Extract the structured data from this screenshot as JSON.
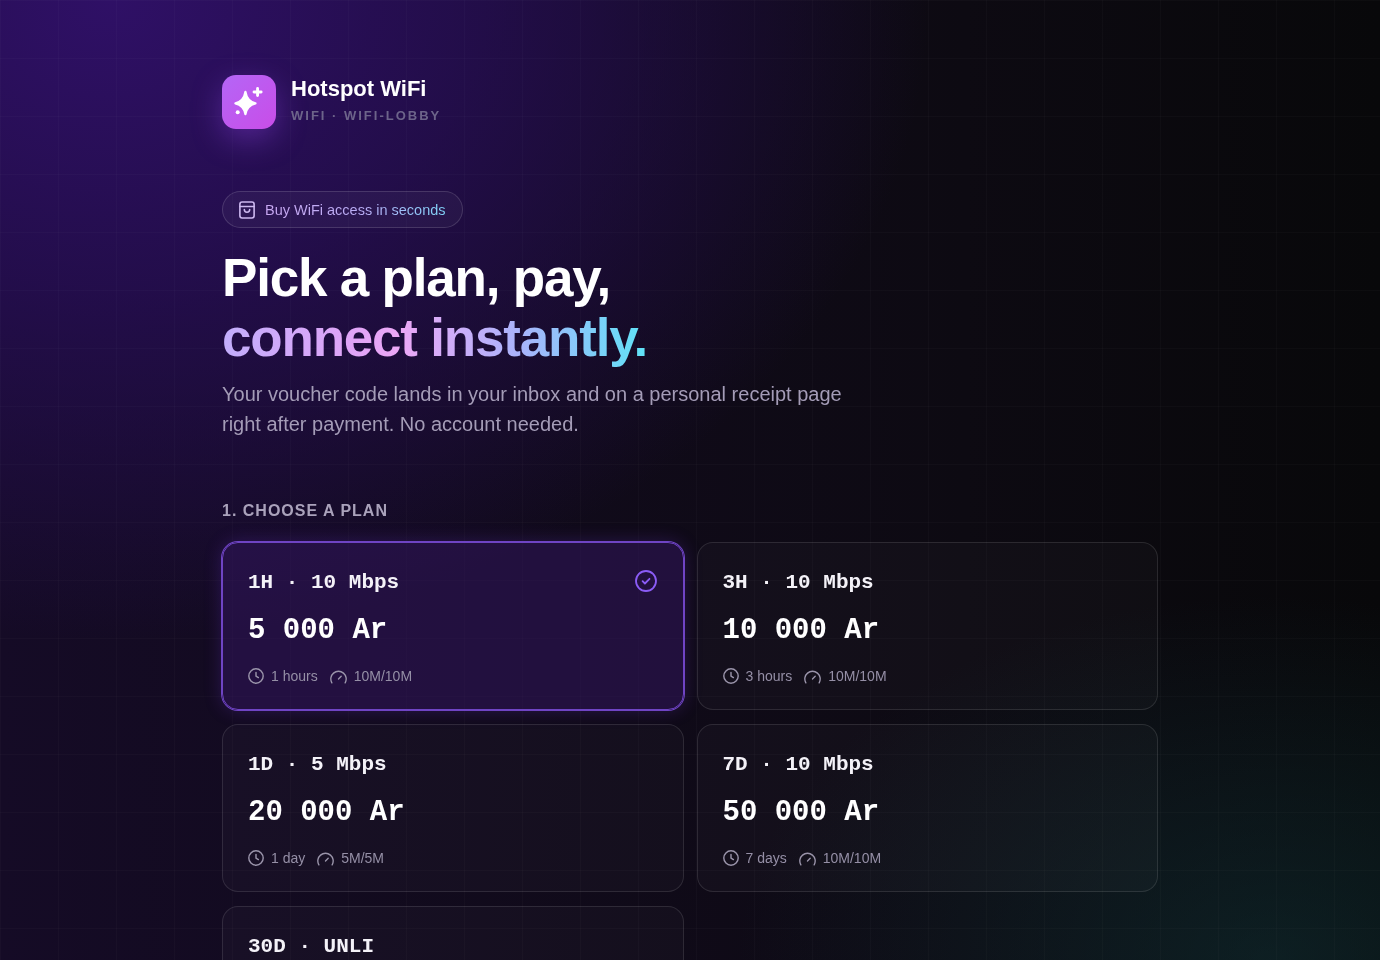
{
  "brand": {
    "name": "Hotspot WiFi",
    "subtitle": "WIFI · WIFI-LOBBY"
  },
  "badge": {
    "text": "Buy WiFi access in seconds"
  },
  "headline": {
    "line_1": "Pick a plan, pay,",
    "line_2": "connect instantly."
  },
  "intro": "Your voucher code lands in your inbox and on a personal receipt page right after payment. No account needed.",
  "plan_section": {
    "title": "1. CHOOSE A PLAN"
  },
  "plans": [
    {
      "title": "1H · 10 Mbps",
      "price": "5 000 Ar",
      "duration": "1 hours",
      "speed": "10M/10M",
      "selected": true
    },
    {
      "title": "3H · 10 Mbps",
      "price": "10 000 Ar",
      "duration": "3 hours",
      "speed": "10M/10M",
      "selected": false
    },
    {
      "title": "1D · 5 Mbps",
      "price": "20 000 Ar",
      "duration": "1 day",
      "speed": "5M/5M",
      "selected": false
    },
    {
      "title": "7D · 10 Mbps",
      "price": "50 000 Ar",
      "duration": "7 days",
      "speed": "10M/10M",
      "selected": false
    },
    {
      "title": "30D · UNLI",
      "selected": false
    }
  ]
}
